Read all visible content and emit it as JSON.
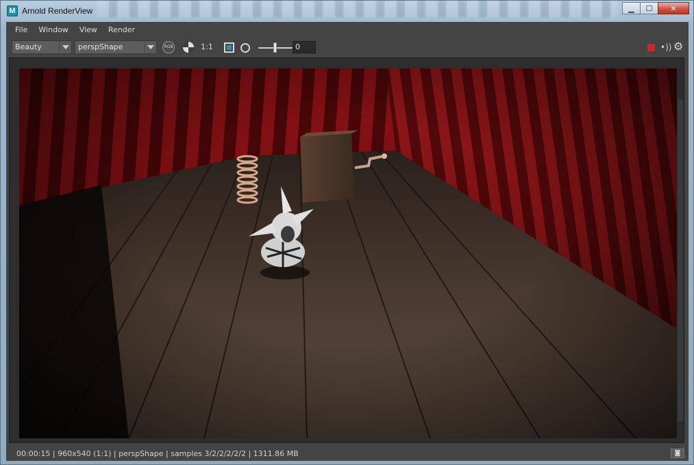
{
  "window": {
    "title": "Arnold RenderView",
    "app_icon": "M",
    "controls": {
      "minimize": "▁",
      "maximize": "☐",
      "close": "✕"
    }
  },
  "menubar": {
    "items": [
      {
        "label": "File"
      },
      {
        "label": "Window"
      },
      {
        "label": "View"
      },
      {
        "label": "Render"
      }
    ]
  },
  "toolbar": {
    "aov_select": {
      "value": "Beauty"
    },
    "camera_select": {
      "value": "perspShape"
    },
    "rgb_label": "RGB",
    "zoom_label": "1:1",
    "exposure_value": "0",
    "exposure_slider_level": 0.5,
    "icons": [
      "rgb-channel-icon",
      "checker-icon",
      "region-frame-icon",
      "aperture-icon",
      "stop-icon",
      "refresh-icon",
      "gear-icon"
    ]
  },
  "status": {
    "text": "00:00:15 | 960x540 (1:1) | perspShape  | samples 3/2/2/2/2/2 | 1311.86 MB"
  },
  "colors": {
    "panel_bg": "#444444",
    "stop_red": "#c52b2b",
    "wallpaper_red": "#8b0f12",
    "floor_wood": "#3b2e26"
  }
}
